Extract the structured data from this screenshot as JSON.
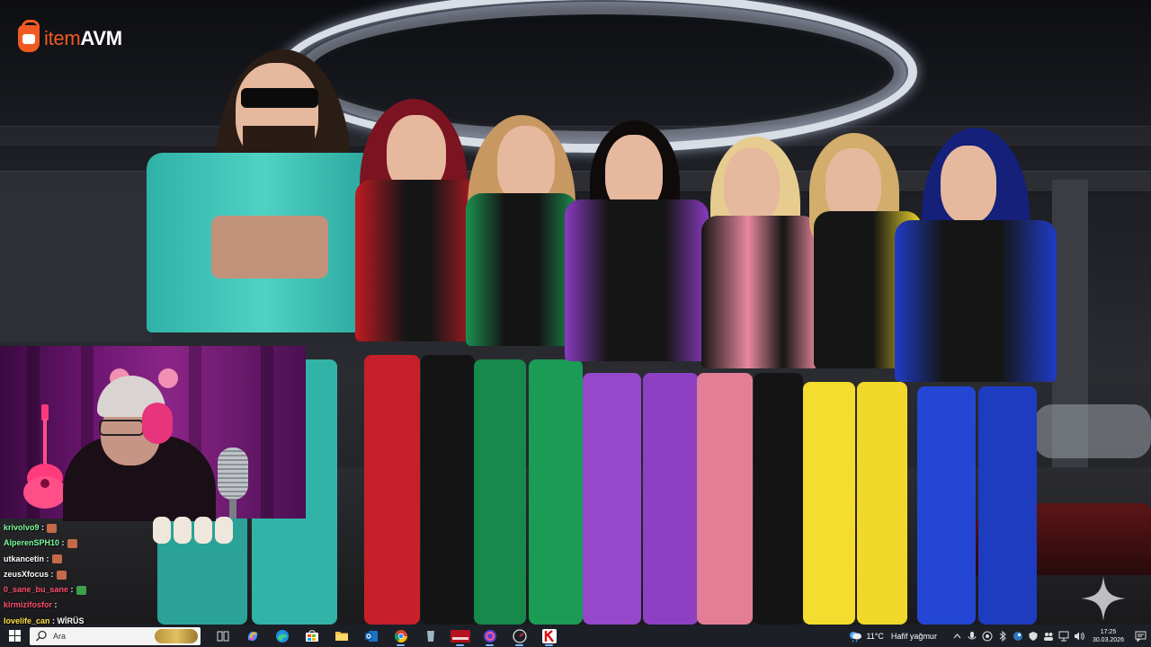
{
  "logo": {
    "brand_part1": "item",
    "brand_part2": "AVM",
    "color": "#f05a22"
  },
  "chat": {
    "messages": [
      {
        "user": "krivolvo9",
        "separator": " :",
        "text": "",
        "user_color": "#7CFC9A",
        "emote_color": "#c46a4a"
      },
      {
        "user": "AlperenSPH10",
        "separator": " :",
        "text": "",
        "user_color": "#7CFC9A",
        "emote_color": "#c46a4a"
      },
      {
        "user": "utkancetin",
        "separator": " :",
        "text": "",
        "user_color": "#ffffff",
        "emote_color": "#c46a4a"
      },
      {
        "user": "zeusXfocus",
        "separator": " :",
        "text": "",
        "user_color": "#ffffff",
        "emote_color": "#c46a4a"
      },
      {
        "user": "0_sane_bu_sane",
        "separator": " :",
        "text": "",
        "user_color": "#ff4f6d",
        "emote_color": "#3aa04a"
      },
      {
        "user": "kirmizifosfor",
        "separator": " :",
        "text": "",
        "user_color": "#ff4f6d",
        "emote_color": ""
      },
      {
        "user": "lovelife_can",
        "separator": " :",
        "text": "WİRÜS",
        "user_color": "#ffe24a",
        "emote_color": ""
      }
    ]
  },
  "taskbar": {
    "search_placeholder": "Ara",
    "apps": [
      {
        "name": "task-view",
        "icon": "task-view-icon",
        "active": false
      },
      {
        "name": "copilot",
        "icon": "copilot-icon",
        "active": false
      },
      {
        "name": "edge",
        "icon": "edge-icon",
        "active": false
      },
      {
        "name": "microsoft-store",
        "icon": "store-icon",
        "active": false
      },
      {
        "name": "file-explorer",
        "icon": "folder-icon",
        "active": false
      },
      {
        "name": "outlook",
        "icon": "outlook-icon",
        "active": false
      },
      {
        "name": "chrome",
        "icon": "chrome-icon",
        "active": true
      },
      {
        "name": "app-glass",
        "icon": "glass-icon",
        "active": false
      },
      {
        "name": "obs-event",
        "icon": "event-badge-icon",
        "active": true
      },
      {
        "name": "app-purple",
        "icon": "app-swirl-icon",
        "active": true
      },
      {
        "name": "app-speed",
        "icon": "speedometer-icon",
        "active": true
      },
      {
        "name": "app-k",
        "icon": "k-app-icon",
        "active": true
      }
    ],
    "weather": {
      "temp": "11°C",
      "desc": "Hafif yağmur"
    },
    "clock": {
      "time": "17:25",
      "date": "30.03.2026"
    }
  }
}
